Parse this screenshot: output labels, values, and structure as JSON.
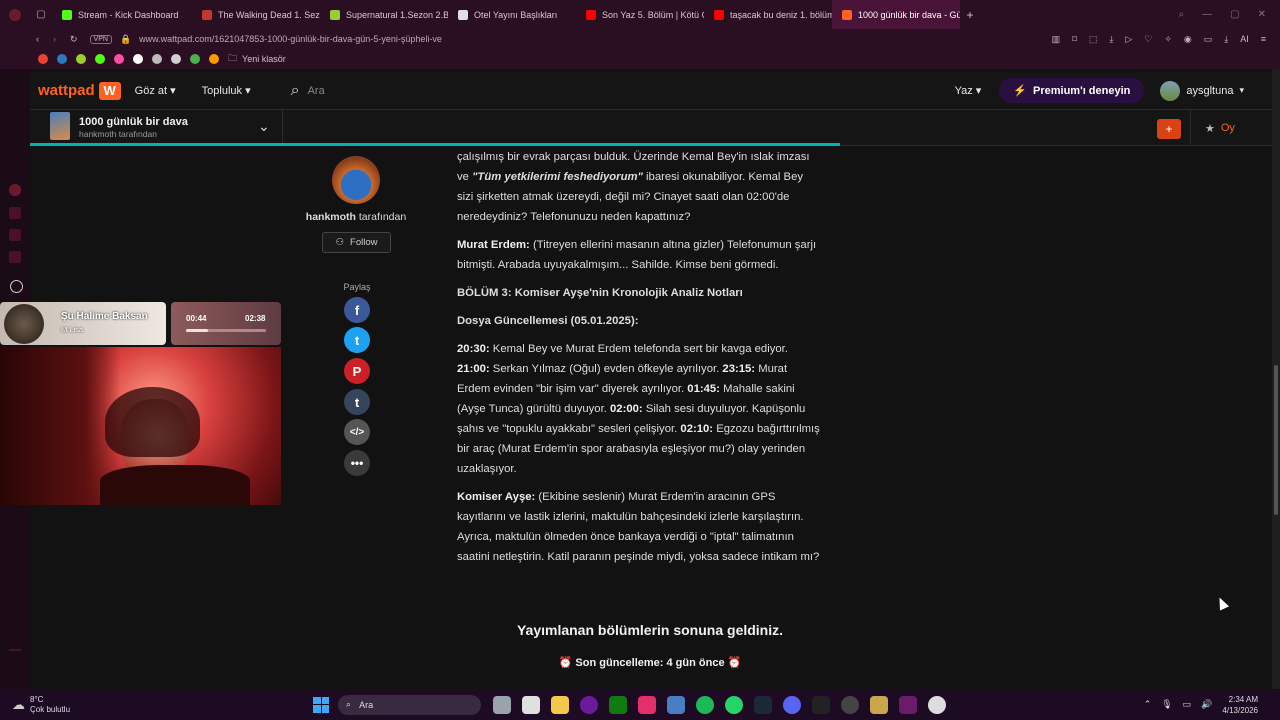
{
  "browser": {
    "tabs": [
      {
        "label": "Stream - Kick Dashboard",
        "color": "#53fc18"
      },
      {
        "label": "The Walking Dead 1. Sezo",
        "color": "#c0392b"
      },
      {
        "label": "Supernatural 1.Sezon 2.Bö",
        "color": "#9acd32"
      },
      {
        "label": "Otel Yayını Başlıkları",
        "color": "#e0e0e0"
      },
      {
        "label": "Son Yaz 5. Bölüm | Kötü Ç",
        "color": "#ff0000"
      },
      {
        "label": "taşacak bu deniz 1. bölüm",
        "color": "#ff0000"
      },
      {
        "label": "1000 günlük bir dava - Gün",
        "color": "#ff6122"
      }
    ],
    "new_tab": "+",
    "vpn": "VPN",
    "url": "www.wattpad.com/1621047853-1000-günlük-bir-dava-gün-5-yeni-şüpheli-ve",
    "bookmark_folder": "Yeni klasör"
  },
  "header": {
    "logo": "wattpad",
    "nav_browse": "Göz at",
    "nav_community": "Topluluk",
    "search_placeholder": "Ara",
    "write": "Yaz",
    "premium": "Premium'ı deneyin",
    "username": "aysgltuna"
  },
  "story": {
    "title": "1000 günlük bir dava",
    "author_line": "hankmoth tarafından",
    "add_button": "+",
    "vote": "Oy"
  },
  "author": {
    "name": "hankmoth",
    "by": "tarafından",
    "follow": "Follow",
    "share_label": "Paylaş"
  },
  "share_icons": [
    "facebook-icon",
    "twitter-icon",
    "pinterest-icon",
    "tumblr-icon",
    "embed-icon",
    "more-icon"
  ],
  "chapter": {
    "p1": "çalışılmış bir evrak parçası bulduk. Üzerinde Kemal Bey'in ıslak imzası ve",
    "p1_quote": "\"Tüm yetkilerimi feshediyorum\"",
    "p1_rest": "ibaresi okunabiliyor. Kemal Bey sizi şirketten atmak üzereydi, değil mi? Cinayet saati olan 02:00'de neredeydiniz? Telefonunuzu neden kapattınız?",
    "p2_speaker": "Murat Erdem:",
    "p2_text": "(Titreyen ellerini masanın altına gizler) Telefonumun şarjı bitmişti. Arabada uyuyakalmışım... Sahilde. Kimse beni görmedi.",
    "section": "BÖLÜM 3: Komiser Ayşe'nin Kronolojik Analiz Notları",
    "file_update": "Dosya Güncellemesi (05.01.2025):",
    "t1": "20:30:",
    "t1_text": "Kemal Bey ve Murat Erdem telefonda sert bir kavga ediyor.",
    "t2": "21:00:",
    "t2_text": "Serkan Yılmaz (Oğul) evden öfkeyle ayrılıyor.",
    "t3": "23:15:",
    "t3_text": "Murat Erdem evinden \"bir işim var\" diyerek ayrılıyor.",
    "t4": "01:45:",
    "t4_text": "Mahalle sakini (Ayşe Tunca) gürültü duyuyor.",
    "t5": "02:00:",
    "t5_text": "Silah sesi duyuluyor. Kapüşonlu şahıs ve \"topuklu ayakkabı\" sesleri çelişiyor.",
    "t6": "02:10:",
    "t6_text": "Egzozu bağırttırılmış bir araç (Murat Erdem'in spor arabasıyla eşleşiyor mu?) olay yerinden uzaklaşıyor.",
    "p5_speaker": "Komiser Ayşe:",
    "p5_text": "(Ekibine seslenir) Murat Erdem'in aracının GPS kayıtlarını ve lastik izlerini, maktulün bahçesindeki izlerle karşılaştırın. Ayrıca, maktulün ölmeden önce bankaya verdiği o \"iptal\" talimatının saatini netleştirin. Katil paranın peşinde miydi, yoksa sadece intikam mı?",
    "end_title": "Yayımlanan bölümlerin sonuna geldiniz.",
    "last_update": "Son güncelleme: 4 gün önce"
  },
  "music": {
    "title": "Şu Halime Baksan",
    "artist": "M Lisa",
    "elapsed": "00:44",
    "total": "02:38",
    "progress": 0.28
  },
  "taskbar": {
    "temp": "8°C",
    "weather": "Çok bulutlu",
    "search": "Ara",
    "time": "2:34 AM",
    "date": "4/13/2026"
  }
}
